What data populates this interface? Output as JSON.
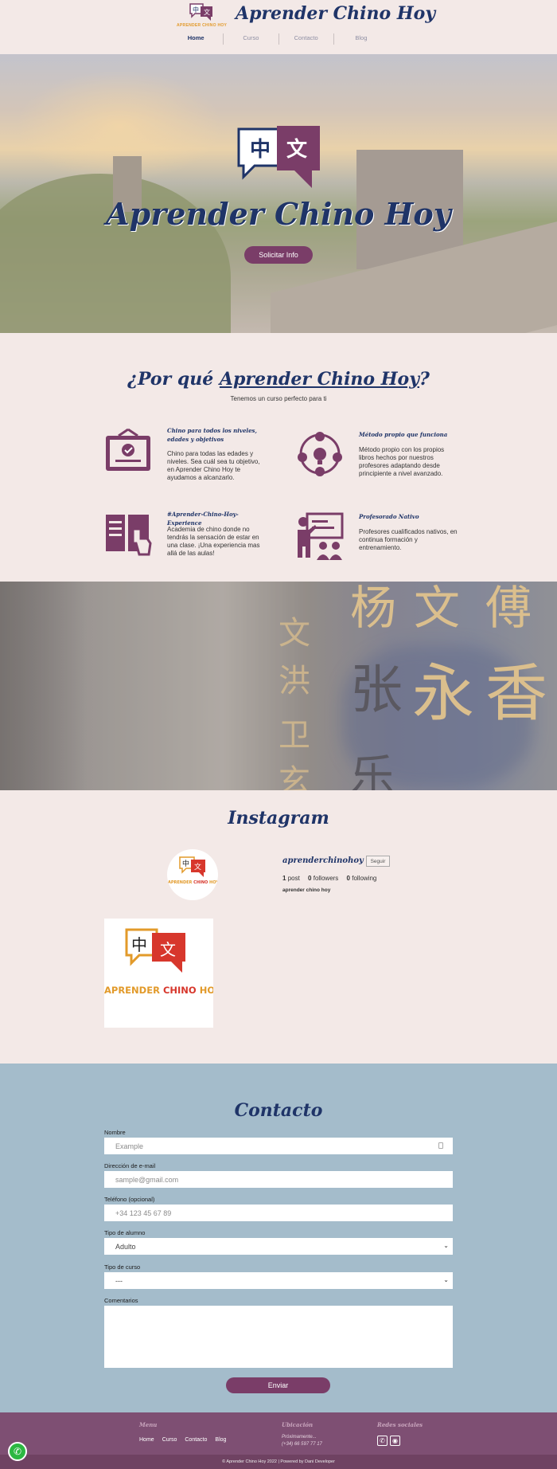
{
  "header": {
    "logo_text": "APRENDER CHINO HOY",
    "title": "Aprender Chino Hoy",
    "nav": [
      "Home",
      "Curso",
      "Contacto",
      "Blog"
    ],
    "active_nav": "Home"
  },
  "hero": {
    "logo_chars": [
      "中",
      "文"
    ],
    "title": "Aprender Chino Hoy",
    "button_label": "Solicitar Info"
  },
  "why": {
    "title_prefix": "¿Por qué ",
    "title_link": "Aprender Chino Hoy",
    "title_suffix": "?",
    "subtitle": "Tenemos un curso perfecto para ti",
    "features": [
      {
        "icon": "certificate-icon",
        "title": "Chino para todos los niveles, edades y objetivos",
        "text": "Chino para todas las edades y niveles. Sea cuál sea tu objetivo, en Aprender Chino Hoy te ayudamos a alcanzarlo."
      },
      {
        "icon": "team-idea-icon",
        "title": "Método propio que funciona",
        "text": "Método propio con los propios libros hechos por nuestros profesores adaptando desde principiente a nivel avanzado."
      },
      {
        "icon": "book-touch-icon",
        "title": "#Aprender-Chino-Hoy-Experience",
        "text": "Academia de chino donde no tendrás la sensación de estar en una clase. ¡Una experiencia mas allá de las aulas!"
      },
      {
        "icon": "teacher-icon",
        "title": "Profesorado Nativo",
        "text": "Profesores cualificados nativos, en continua formación y entrenamiento."
      }
    ]
  },
  "band": {
    "chars": [
      "杨",
      "文",
      "傅",
      "张",
      "永",
      "香",
      "文",
      "洪",
      "卫",
      "乐",
      "玄"
    ]
  },
  "instagram": {
    "title": "Instagram",
    "username": "aprenderchinohoy",
    "follow_label": "Seguir",
    "posts_count": "1",
    "posts_label": "post",
    "followers_count": "0",
    "followers_label": "followers",
    "following_count": "0",
    "following_label": "following",
    "display_name": "aprender chino hoy",
    "post_logo_text_a": "APRENDER ",
    "post_logo_text_b": "CHINO",
    "post_logo_text_c": " HOY"
  },
  "contact": {
    "title": "Contacto",
    "name_label": "Nombre",
    "name_placeholder": "Example",
    "email_label": "Dirección de e-mail",
    "email_placeholder": "sample@gmail.com",
    "phone_label": "Teléfono (opcional)",
    "phone_placeholder": "+34 123 45 67 89",
    "student_label": "Tipo de alumno",
    "student_value": "Adulto",
    "course_label": "Tipo de curso",
    "course_value": "---",
    "comments_label": "Comentarios",
    "send_label": "Enviar"
  },
  "footer": {
    "menu_title": "Menu",
    "menu_links": [
      "Home",
      "Curso",
      "Contacto",
      "Blog"
    ],
    "location_title": "Ubicación",
    "location_line1": "Próximamente...",
    "location_line2": "(+34) 66 597 77 17",
    "social_title": "Redes sociales",
    "copyright": "© Aprender Chino Hoy 2022 | Powered by Dani Developer"
  },
  "colors": {
    "brand_purple": "#7a3d68",
    "title_navy": "#1f3468",
    "contact_bg": "#a4bccb",
    "page_bg": "#f3e9e7",
    "footer_bg": "#7e4f73"
  }
}
